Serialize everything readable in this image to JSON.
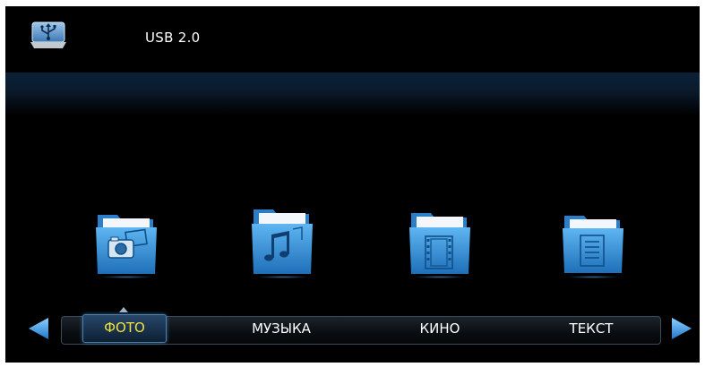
{
  "header": {
    "device_icon": "usb-icon",
    "device_label": "USB 2.0"
  },
  "categories": [
    {
      "label": "ФОТО",
      "icon": "photo-folder-icon",
      "selected": true
    },
    {
      "label": "МУЗЫКА",
      "icon": "music-folder-icon",
      "selected": false
    },
    {
      "label": "КИНО",
      "icon": "movie-folder-icon",
      "selected": false
    },
    {
      "label": "ТЕКСТ",
      "icon": "text-folder-icon",
      "selected": false
    }
  ],
  "navigation": {
    "left_icon": "arrow-left-icon",
    "right_icon": "arrow-right-icon"
  },
  "colors": {
    "background": "#000000",
    "selected_text": "#f0e23a",
    "folder_blue": "#2f8fd8",
    "arrow_blue": "#3a9de8"
  }
}
